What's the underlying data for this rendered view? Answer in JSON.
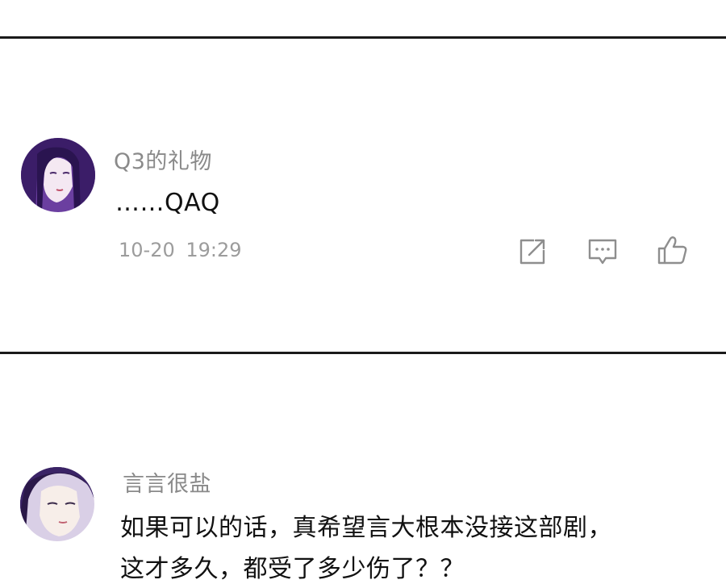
{
  "comments": [
    {
      "username": "Q3的礼物",
      "text": "……QAQ",
      "timestamp": "10-20  19:29",
      "actions": [
        "share-icon",
        "reply-icon",
        "like-icon"
      ],
      "avatar_colors": {
        "bg": "#5a2f8a",
        "hair": "#3a1a6a",
        "skin": "#f3e6f0"
      }
    },
    {
      "username": "言言很盐",
      "text_line1": "如果可以的话，真希望言大根本没接这部剧，",
      "text_line2": "这才多久，都受了多少伤了？？",
      "avatar_colors": {
        "bg": "#6a4fa0",
        "hair": "#2a1848",
        "skin": "#f6ece8"
      }
    }
  ]
}
